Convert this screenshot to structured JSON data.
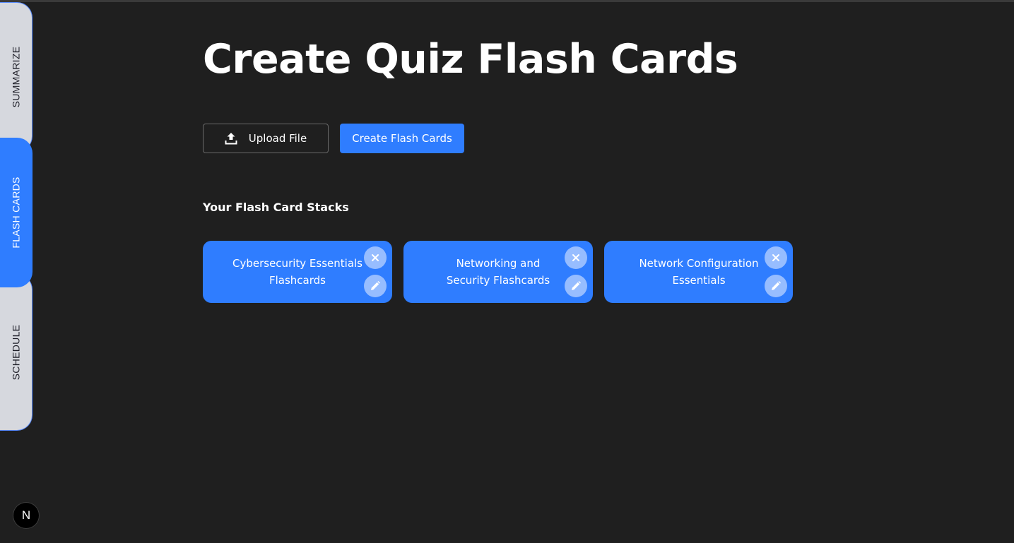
{
  "sidebar": {
    "tabs": [
      {
        "label": "SUMMARIZE",
        "active": false
      },
      {
        "label": "FLASH CARDS",
        "active": true
      },
      {
        "label": "SCHEDULE",
        "active": false
      }
    ]
  },
  "main": {
    "title": "Create Quiz Flash Cards",
    "upload_button": {
      "label": "Upload File",
      "icon": "upload-icon"
    },
    "create_button": {
      "label": "Create Flash Cards"
    },
    "stacks_heading": "Your Flash Card Stacks",
    "stacks": [
      {
        "title": "Cybersecurity Essentials Flashcards"
      },
      {
        "title": "Networking and Security Flashcards"
      },
      {
        "title": "Network Configuration Essentials"
      }
    ]
  },
  "badge": {
    "letter": "N"
  },
  "colors": {
    "background": "#1f1f1f",
    "accent": "#2f7dff",
    "tab_inactive": "#d6d8de",
    "card_button": "#97bdff"
  }
}
